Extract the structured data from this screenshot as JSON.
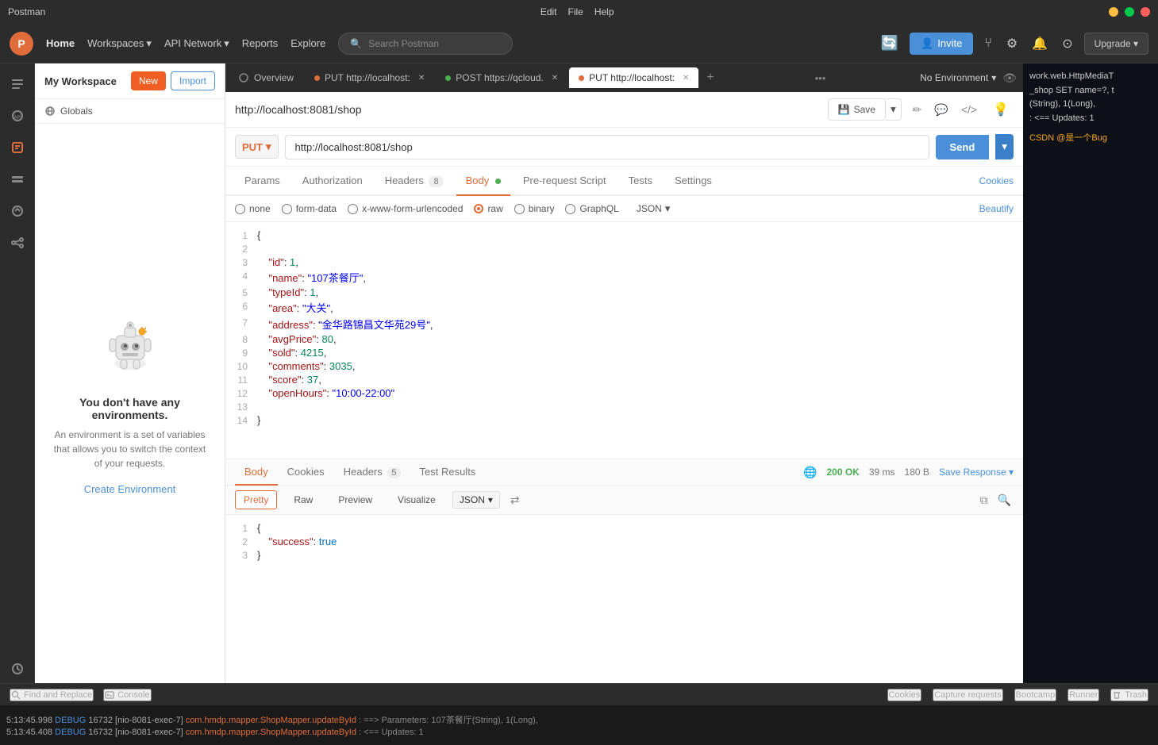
{
  "titlebar": {
    "app_name": "Postman",
    "menus": [
      "Edit",
      "File",
      "Help"
    ],
    "min_label": "—",
    "max_label": "□",
    "close_label": "✕"
  },
  "topnav": {
    "home": "Home",
    "workspaces": "Workspaces",
    "api_network": "API Network",
    "reports": "Reports",
    "explore": "Explore",
    "search_placeholder": "Search Postman",
    "invite_label": "Invite",
    "upgrade_label": "Upgrade"
  },
  "sidebar": {
    "workspace_title": "My Workspace",
    "new_btn": "New",
    "import_btn": "Import",
    "globals_label": "Globals",
    "env_title": "You don't have any environments.",
    "env_desc": "An environment is a set of variables that allows you to switch the context of your requests.",
    "create_env": "Create Environment",
    "icons": [
      "collections",
      "apis",
      "environments",
      "mock-servers",
      "monitors",
      "flows",
      "history"
    ]
  },
  "tabs": [
    {
      "id": "tab1",
      "label": "Overview",
      "method": "",
      "dot_color": ""
    },
    {
      "id": "tab2",
      "label": "PUT http://localhost:",
      "method": "PUT",
      "dot_color": "orange"
    },
    {
      "id": "tab3",
      "label": "POST https://qcloud.",
      "method": "POST",
      "dot_color": "green"
    },
    {
      "id": "tab4",
      "label": "PUT http://localhost:",
      "method": "PUT",
      "dot_color": "orange",
      "active": true
    }
  ],
  "no_env_label": "No Environment",
  "request": {
    "url_path": "http://localhost:8081/shop",
    "method": "PUT",
    "url": "http://localhost:8081/shop",
    "save_label": "Save",
    "tabs": [
      "Params",
      "Authorization",
      "Headers",
      "Body",
      "Pre-request Script",
      "Tests",
      "Settings"
    ],
    "headers_badge": "8",
    "body_active": true,
    "cookies_label": "Cookies",
    "body_options": [
      "none",
      "form-data",
      "x-www-form-urlencoded",
      "raw",
      "binary",
      "GraphQL"
    ],
    "raw_selected": true,
    "json_format": "JSON",
    "beautify_label": "Beautify",
    "code_lines": [
      {
        "num": 1,
        "content": "{"
      },
      {
        "num": 2,
        "content": ""
      },
      {
        "num": 3,
        "content": "    \"id\": 1,"
      },
      {
        "num": 4,
        "content": "    \"name\": \"107茶餐厅\","
      },
      {
        "num": 5,
        "content": "    \"typeId\": 1,"
      },
      {
        "num": 6,
        "content": "    \"area\": \"大关\","
      },
      {
        "num": 7,
        "content": "    \"address\": \"金华路锦昌文华苑29号\","
      },
      {
        "num": 8,
        "content": "    \"avgPrice\": 80,"
      },
      {
        "num": 9,
        "content": "    \"sold\": 4215,"
      },
      {
        "num": 10,
        "content": "    \"comments\": 3035,"
      },
      {
        "num": 11,
        "content": "    \"score\": 37,"
      },
      {
        "num": 12,
        "content": "    \"openHours\": \"10:00-22:00\""
      },
      {
        "num": 13,
        "content": ""
      },
      {
        "num": 14,
        "content": "}"
      }
    ]
  },
  "response": {
    "tabs": [
      "Body",
      "Cookies",
      "Headers",
      "Test Results"
    ],
    "headers_badge": "5",
    "status": "200 OK",
    "time": "39 ms",
    "size": "180 B",
    "save_resp": "Save Response",
    "view_tabs": [
      "Pretty",
      "Raw",
      "Preview",
      "Visualize"
    ],
    "format": "JSON",
    "resp_lines": [
      {
        "num": 1,
        "content": "{"
      },
      {
        "num": 2,
        "content": "    \"success\": true"
      },
      {
        "num": 3,
        "content": "}"
      }
    ]
  },
  "bottombar": {
    "find_replace": "Find and Replace",
    "console": "Console",
    "cookies_label": "Cookies",
    "capture_requests": "Capture requests",
    "bootcamp": "Bootcamp",
    "runner": "Runner",
    "trash": "Trash"
  },
  "log": {
    "line1": "5:13:45.998 DEBUG 16732 [nio-8081-exec-7] com.hmdp.mapper.ShopMapper.updateById : ==> Parameters: 107茶餐厅(String), 1(Long),",
    "line2": "5:13:45.408 DEBUG 16732 [nio-8081-exec-7] com.hmdp.mapper.ShopMapper.updateById : <==    Updates: 1"
  },
  "csdn": {
    "title": "CSDN @是一个Bug",
    "code1": "work.web.HttpMediaT",
    "code2": "_shop SET name=?, t",
    "code3": "(String), 1(Long),",
    "code4": ": <==    Updates: 1",
    "code5": "CSDN @是一个Bug"
  }
}
